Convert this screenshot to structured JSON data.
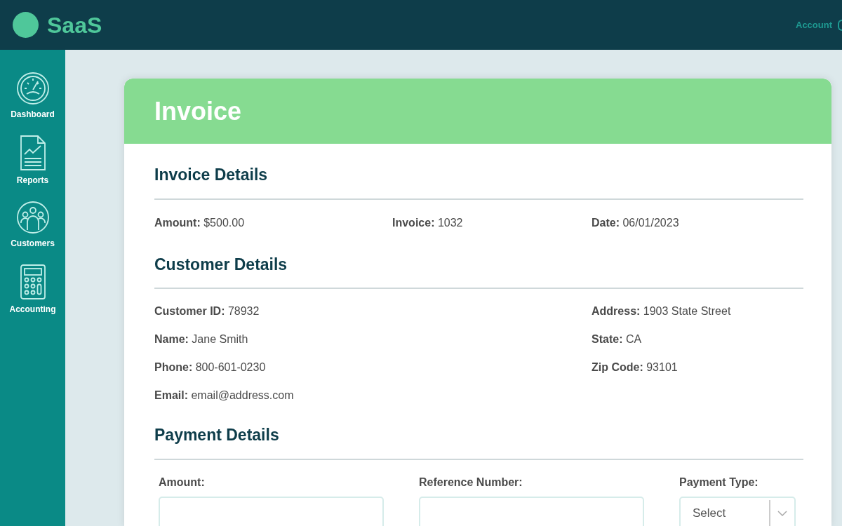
{
  "header": {
    "logo": "SaaS",
    "account": "Account"
  },
  "sidebar": {
    "items": [
      {
        "label": "Dashboard",
        "selected": false
      },
      {
        "label": "Reports",
        "selected": false
      },
      {
        "label": "Customers",
        "selected": false
      },
      {
        "label": "Accounting",
        "selected": false
      }
    ]
  },
  "card": {
    "title": "Invoice",
    "invoice_details": {
      "heading": "Invoice Details",
      "fields": [
        {
          "label": "Amount:",
          "value": "$500.00"
        },
        {
          "label": "Invoice:",
          "value": "1032"
        },
        {
          "label": "Date:",
          "value": "06/01/2023"
        }
      ]
    },
    "customer_details": {
      "heading": "Customer Details",
      "left": [
        {
          "label": "Customer ID:",
          "value": "78932"
        },
        {
          "label": "Name:",
          "value": "Jane Smith"
        },
        {
          "label": "Phone:",
          "value": "800-601-0230"
        },
        {
          "label": "Email:",
          "value": "email@address.com"
        }
      ],
      "right": [
        {
          "label": "Address:",
          "value": "1903 State Street"
        },
        {
          "label": "State:",
          "value": "CA"
        },
        {
          "label": "Zip Code:",
          "value": "93101"
        }
      ]
    },
    "payment_details": {
      "heading": "Payment Details",
      "fields": [
        {
          "label": "Amount:",
          "kind": "text"
        },
        {
          "label": "Reference Number:",
          "kind": "text"
        },
        {
          "label": "Payment Type:",
          "kind": "select",
          "placeholder": "Select"
        }
      ]
    }
  }
}
